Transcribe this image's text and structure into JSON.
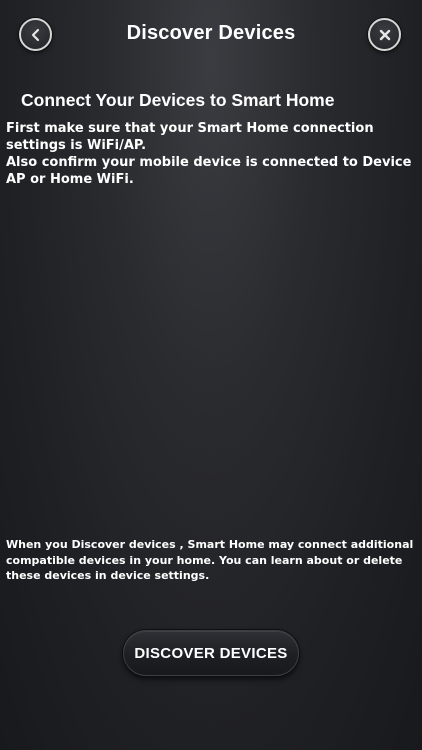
{
  "header": {
    "title": "Discover Devices",
    "back_icon": "chevron-left-icon",
    "close_icon": "close-icon"
  },
  "main": {
    "heading": "Connect Your Devices to Smart Home",
    "intro_line1": "First make sure that your Smart Home connection settings is WiFi/AP.",
    "intro_line2": "Also confirm your mobile device is connected to Device AP or Home WiFi.",
    "footnote": "When you Discover devices , Smart Home  may connect additional compatible devices in your home. You can learn about or delete these devices in device settings."
  },
  "actions": {
    "discover_label": "DISCOVER DEVICES"
  },
  "colors": {
    "background": "#1f2024",
    "text": "#ffffff",
    "button_border": "#d6d6d6"
  }
}
